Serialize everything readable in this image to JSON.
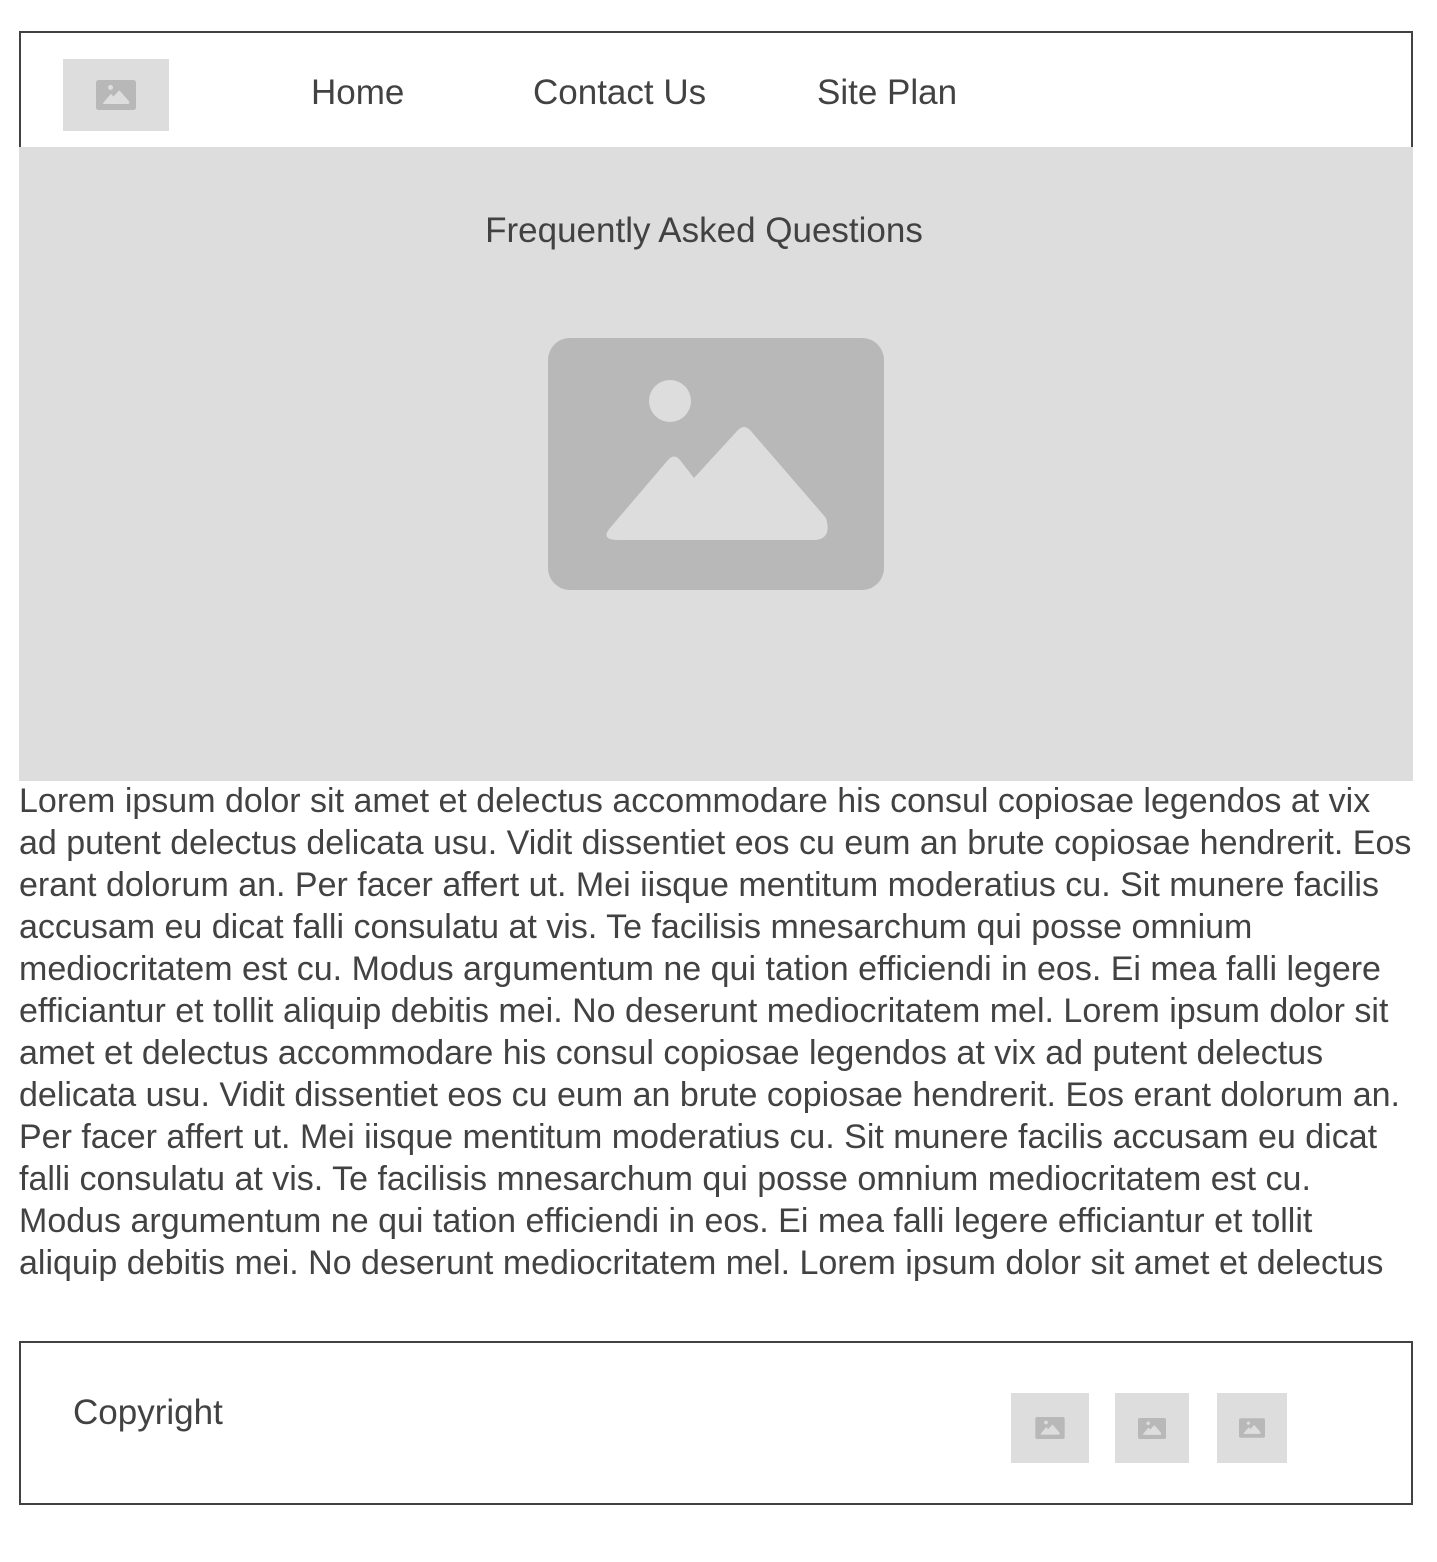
{
  "header": {
    "logo_icon": "image-placeholder-icon",
    "nav": [
      {
        "label": "Home"
      },
      {
        "label": "Contact Us"
      },
      {
        "label": "Site Plan"
      }
    ]
  },
  "hero": {
    "title": "Frequently Asked Questions",
    "image_icon": "image-placeholder-icon"
  },
  "body_text": "Lorem ipsum dolor sit amet et delectus accommodare his consul copiosae legendos at vix ad putent delectus delicata usu. Vidit dissentiet eos cu eum an brute copiosae hendrerit. Eos erant dolorum an. Per facer affert ut. Mei iisque mentitum moderatius cu. Sit munere facilis accusam eu dicat falli consulatu at vis. Te facilisis mnesarchum qui posse omnium mediocritatem est cu. Modus argumentum ne qui tation efficiendi in eos. Ei mea falli legere efficiantur et tollit aliquip debitis mei. No deserunt mediocritatem mel. Lorem ipsum dolor sit amet et delectus accommodare his consul copiosae legendos at vix ad putent delectus delicata usu. Vidit dissentiet eos cu eum an brute copiosae hendrerit. Eos erant dolorum an. Per facer affert ut. Mei iisque mentitum moderatius cu. Sit munere facilis accusam eu dicat falli consulatu at vis. Te facilisis mnesarchum qui posse omnium mediocritatem est cu. Modus argumentum ne qui tation efficiendi in eos. Ei mea falli legere efficiantur et tollit aliquip debitis mei. No deserunt mediocritatem mel. Lorem ipsum dolor sit amet et delectus",
  "footer": {
    "copyright": "Copyright",
    "social_icons": [
      "image-placeholder-icon",
      "image-placeholder-icon",
      "image-placeholder-icon"
    ]
  },
  "colors": {
    "text": "#424242",
    "placeholder_bg": "#dddddd",
    "placeholder_glyph": "#b8b8b8",
    "border": "#424242"
  }
}
